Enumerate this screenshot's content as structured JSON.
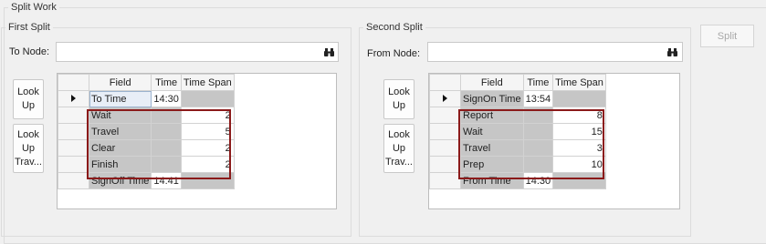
{
  "split_work": {
    "title": "Split Work",
    "split_button_label": "Split"
  },
  "first_split": {
    "title": "First Split",
    "node_label": "To Node:",
    "node_value": "",
    "lookup_label": [
      "Look",
      "Up"
    ],
    "lookup_travel_label": [
      "Look",
      "Up",
      "Trav..."
    ],
    "columns": [
      "Field",
      "Time",
      "Time Span"
    ],
    "rows": [
      {
        "field": "To Time",
        "time": "14:30",
        "span": ""
      },
      {
        "field": "Wait",
        "time": "",
        "span": "2"
      },
      {
        "field": "Travel",
        "time": "",
        "span": "5"
      },
      {
        "field": "Clear",
        "time": "",
        "span": "2"
      },
      {
        "field": "Finish",
        "time": "",
        "span": "2"
      },
      {
        "field": "SignOff Time",
        "time": "14:41",
        "span": ""
      }
    ]
  },
  "second_split": {
    "title": "Second Split",
    "node_label": "From Node:",
    "node_value": "",
    "lookup_label": [
      "Look",
      "Up"
    ],
    "lookup_travel_label": [
      "Look",
      "Up",
      "Trav..."
    ],
    "columns": [
      "Field",
      "Time",
      "Time Span"
    ],
    "rows": [
      {
        "field": "SignOn Time",
        "time": "13:54",
        "span": ""
      },
      {
        "field": "Report",
        "time": "",
        "span": "8"
      },
      {
        "field": "Wait",
        "time": "",
        "span": "15"
      },
      {
        "field": "Travel",
        "time": "",
        "span": "3"
      },
      {
        "field": "Prep",
        "time": "",
        "span": "10"
      },
      {
        "field": "From Time",
        "time": "14:30",
        "span": ""
      }
    ]
  },
  "icons": {
    "binoculars": "binoculars-icon",
    "current_row": "current-row-arrow-icon"
  },
  "colors": {
    "highlight": "#8b1a1a",
    "cell_gray": "#c6c6c6"
  }
}
